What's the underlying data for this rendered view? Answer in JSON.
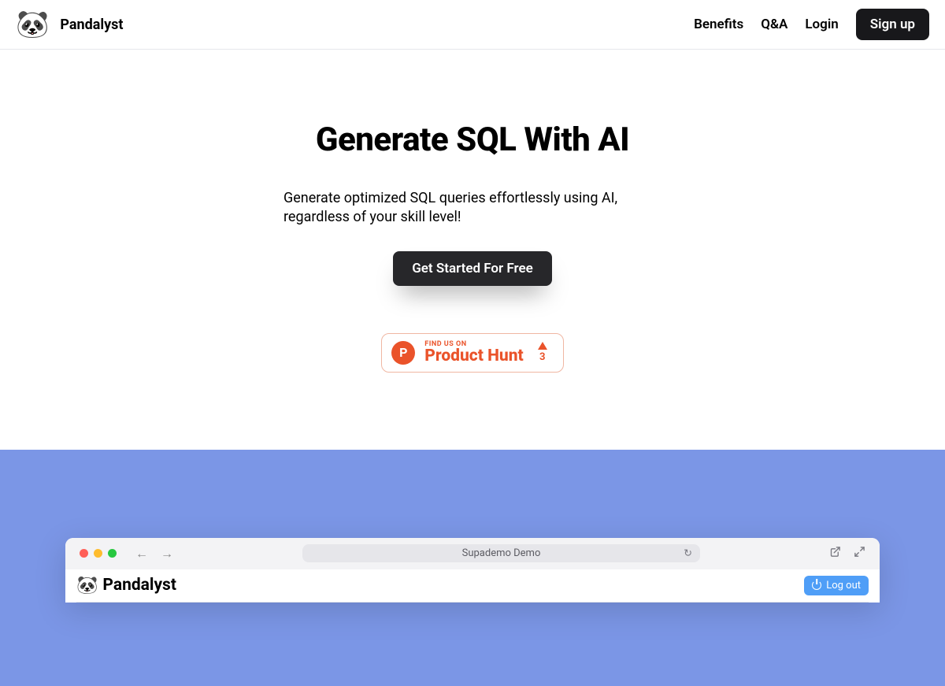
{
  "nav": {
    "brand": "Pandalyst",
    "links": {
      "benefits": "Benefits",
      "qa": "Q&A",
      "login": "Login"
    },
    "signup": "Sign up"
  },
  "hero": {
    "title": "Generate SQL With AI",
    "subtitle": "Generate optimized SQL queries effortlessly using AI, regardless of your skill level!",
    "cta": "Get Started For Free"
  },
  "ph": {
    "small": "FIND US ON",
    "big": "Product Hunt",
    "count": "3"
  },
  "demo": {
    "address": "Supademo Demo",
    "brand": "Pandalyst",
    "logout": "Log out"
  }
}
